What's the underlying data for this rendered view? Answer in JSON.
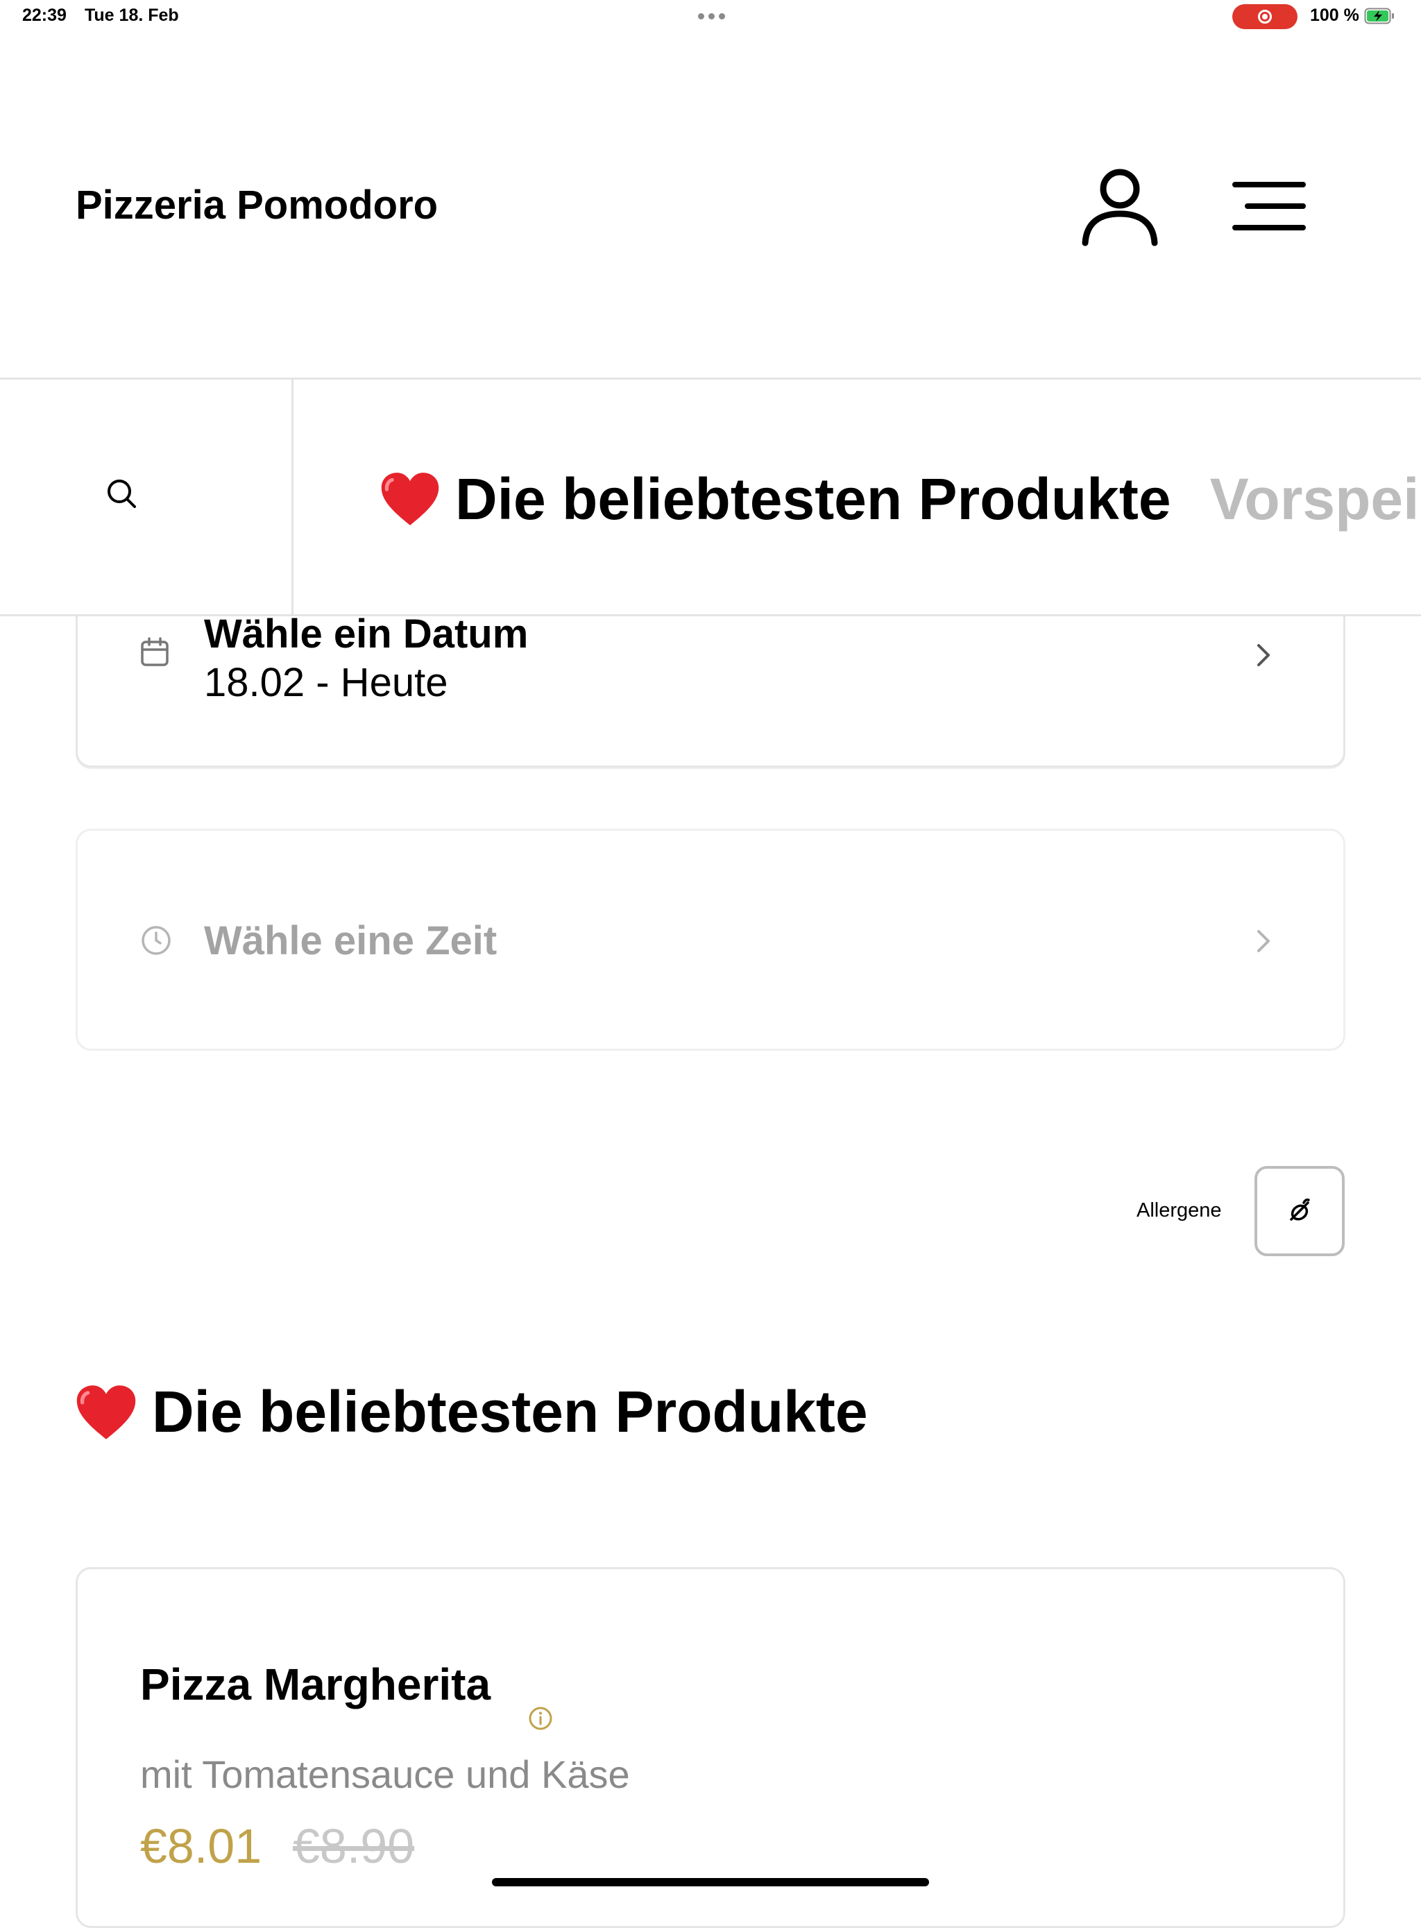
{
  "status_bar": {
    "time": "22:39",
    "date": "Tue 18. Feb",
    "battery_text": "100 %",
    "record_color": "#e0352b",
    "battery_color": "#34c759"
  },
  "header": {
    "brand": "Pizzeria Pomodoro",
    "account_icon": "user-icon",
    "menu_icon": "menu-icon"
  },
  "category_bar": {
    "search_icon": "search-icon",
    "items": [
      {
        "emoji": "heart",
        "label": "Die beliebtesten Produkte",
        "active": true
      },
      {
        "label": "Vorspei",
        "active": false
      }
    ]
  },
  "date_picker": {
    "title": "Wähle ein Datum",
    "value": "18.02 - Heute",
    "icon": "calendar-icon"
  },
  "time_picker": {
    "title": "Wähle eine Zeit",
    "icon": "clock-icon",
    "disabled": true
  },
  "allergens": {
    "label": "Allergene",
    "icon": "allergen-icon"
  },
  "section": {
    "title": "Die beliebtesten Produkte",
    "emoji": "heart"
  },
  "product": {
    "name": "Pizza Margherita",
    "description": "mit Tomatensauce und Käse",
    "price": "€8.01",
    "old_price": "€8.90",
    "price_color": "#c0a24a"
  }
}
